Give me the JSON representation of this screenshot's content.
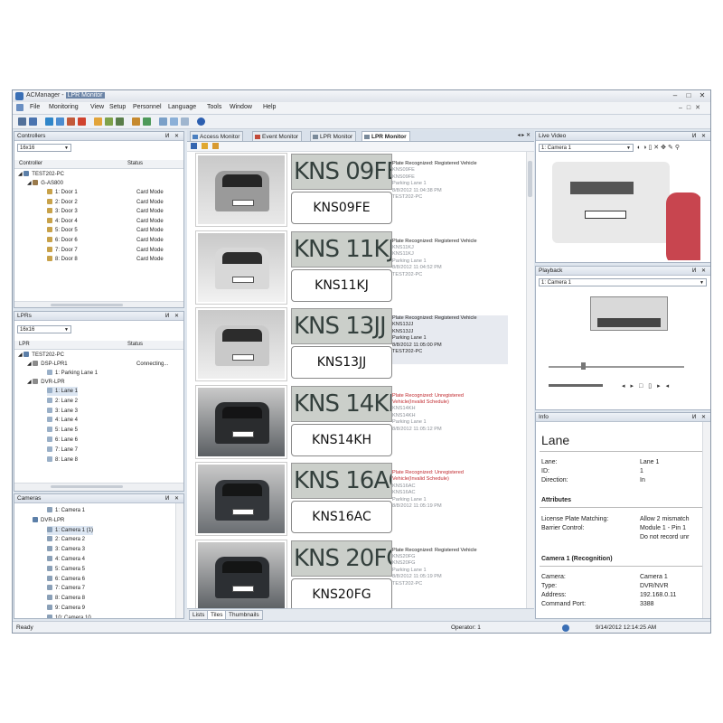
{
  "window": {
    "app_name": "ACManager",
    "doc_title": "LPR Monitor"
  },
  "menu": [
    "File",
    "Monitoring",
    "View",
    "Setup",
    "Personnel",
    "Language",
    "Tools",
    "Window",
    "Help"
  ],
  "controllers": {
    "title": "Controllers",
    "layout": "16x16",
    "col_controller": "Controller",
    "col_status": "Status",
    "root": "TEST202-PC",
    "device": "G-AS800",
    "doors": [
      {
        "label": "1: Door 1",
        "status": "Card Mode"
      },
      {
        "label": "2: Door 2",
        "status": "Card Mode"
      },
      {
        "label": "3: Door 3",
        "status": "Card Mode"
      },
      {
        "label": "4: Door 4",
        "status": "Card Mode"
      },
      {
        "label": "5: Door 5",
        "status": "Card Mode"
      },
      {
        "label": "6: Door 6",
        "status": "Card Mode"
      },
      {
        "label": "7: Door 7",
        "status": "Card Mode"
      },
      {
        "label": "8: Door 8",
        "status": "Card Mode"
      }
    ]
  },
  "lprs": {
    "title": "LPRs",
    "layout": "16x16",
    "col_lpr": "LPR",
    "col_status": "Status",
    "root": "TEST202-PC",
    "dsp": {
      "label": "DSP-LPR1",
      "status": "Connecting...",
      "child": "1: Parking Lane 1"
    },
    "dvr": "DVR-LPR",
    "lanes": [
      "1: Lane 1",
      "2: Lane 2",
      "3: Lane 3",
      "4: Lane 4",
      "5: Lane 5",
      "6: Lane 6",
      "7: Lane 7",
      "8: Lane 8"
    ]
  },
  "cameras": {
    "title": "Cameras",
    "items": [
      "1: Camera 1",
      "DVR-LPR",
      "1: Camera 1 (1)",
      "2: Camera 2",
      "3: Camera 3",
      "4: Camera 4",
      "5: Camera 5",
      "6: Camera 6",
      "7: Camera 7",
      "8: Camera 8",
      "9: Camera 9",
      "10: Camera 10"
    ]
  },
  "tabs": [
    "Access Monitor",
    "Event Monitor",
    "LPR Monitor",
    "LPR Monitor"
  ],
  "entries": [
    {
      "crop": "KNS 09FE",
      "plate": "KNS09FE",
      "status": "Plate Recognized: Registered Vehicle",
      "status2": "",
      "red": false,
      "lines": [
        "KNS09FE",
        "KNS09FE",
        "Parking Lane 1",
        "8/8/2012 11:04:38 PM",
        "TEST202-PC"
      ]
    },
    {
      "crop": "KNS 11KJ",
      "plate": "KNS11KJ",
      "status": "Plate Recognized: Registered Vehicle",
      "status2": "",
      "red": false,
      "lines": [
        "KNS11KJ",
        "KNS11KJ",
        "Parking Lane 1",
        "8/8/2012 11:04:52 PM",
        "TEST202-PC"
      ]
    },
    {
      "crop": "KNS 13JJ",
      "plate": "KNS13JJ",
      "status": "Plate Recognized: Registered Vehicle",
      "status2": "",
      "red": false,
      "lines": [
        "KNS13JJ",
        "KNS13JJ",
        "Parking Lane 1",
        "8/8/2012 11:05:00 PM",
        "TEST202-PC"
      ]
    },
    {
      "crop": "KNS 14KH",
      "plate": "KNS14KH",
      "status": "Plate Recognized: Unregistered",
      "status2": "Vehicle(Invalid Schedule)",
      "red": true,
      "lines": [
        "KNS14KH",
        "KNS14KH",
        "Parking Lane 1",
        "8/8/2012 11:05:12 PM",
        ""
      ]
    },
    {
      "crop": "KNS 16AC",
      "plate": "KNS16AC",
      "status": "Plate Recognized: Unregistered",
      "status2": "Vehicle(Invalid Schedule)",
      "red": true,
      "lines": [
        "KNS16AC",
        "KNS16AC",
        "Parking Lane 1",
        "8/8/2012 11:05:19 PM",
        ""
      ]
    },
    {
      "crop": "KNS 20FG",
      "plate": "KNS20FG",
      "status": "Plate Recognized: Registered Vehicle",
      "status2": "",
      "red": false,
      "lines": [
        "KNS20FG",
        "KNS20FG",
        "Parking Lane 1",
        "8/8/2012 11:05:19 PM",
        "TEST202-PC"
      ]
    }
  ],
  "bottom_tabs": [
    "Lists",
    "Tiles",
    "Thumbnails"
  ],
  "live_video": {
    "title": "Live Video",
    "camera": "1: Camera 1"
  },
  "playback": {
    "title": "Playback",
    "camera": "1: Camera 1"
  },
  "info": {
    "title": "Info",
    "heading": "Lane",
    "fields": [
      {
        "k": "Lane:",
        "v": "Lane 1"
      },
      {
        "k": "ID:",
        "v": "1"
      },
      {
        "k": "Direction:",
        "v": "In"
      }
    ],
    "attributes_title": "Attributes",
    "attributes": [
      {
        "k": "License Plate Matching:",
        "v": "Allow 2 mismatch"
      },
      {
        "k": "Barrier Control:",
        "v": "Module 1 - Pin 1"
      },
      {
        "k": "",
        "v": "Do not record unr"
      }
    ],
    "camera_title": "Camera 1 (Recognition)",
    "camera": [
      {
        "k": "Camera:",
        "v": "Camera 1"
      },
      {
        "k": "Type:",
        "v": "DVR/NVR"
      },
      {
        "k": "Address:",
        "v": "192.168.0.11"
      },
      {
        "k": "Command Port:",
        "v": "3388"
      }
    ]
  },
  "status": {
    "ready": "Ready",
    "operator": "Operator: 1",
    "datetime": "9/14/2012 12:14:25 AM"
  }
}
